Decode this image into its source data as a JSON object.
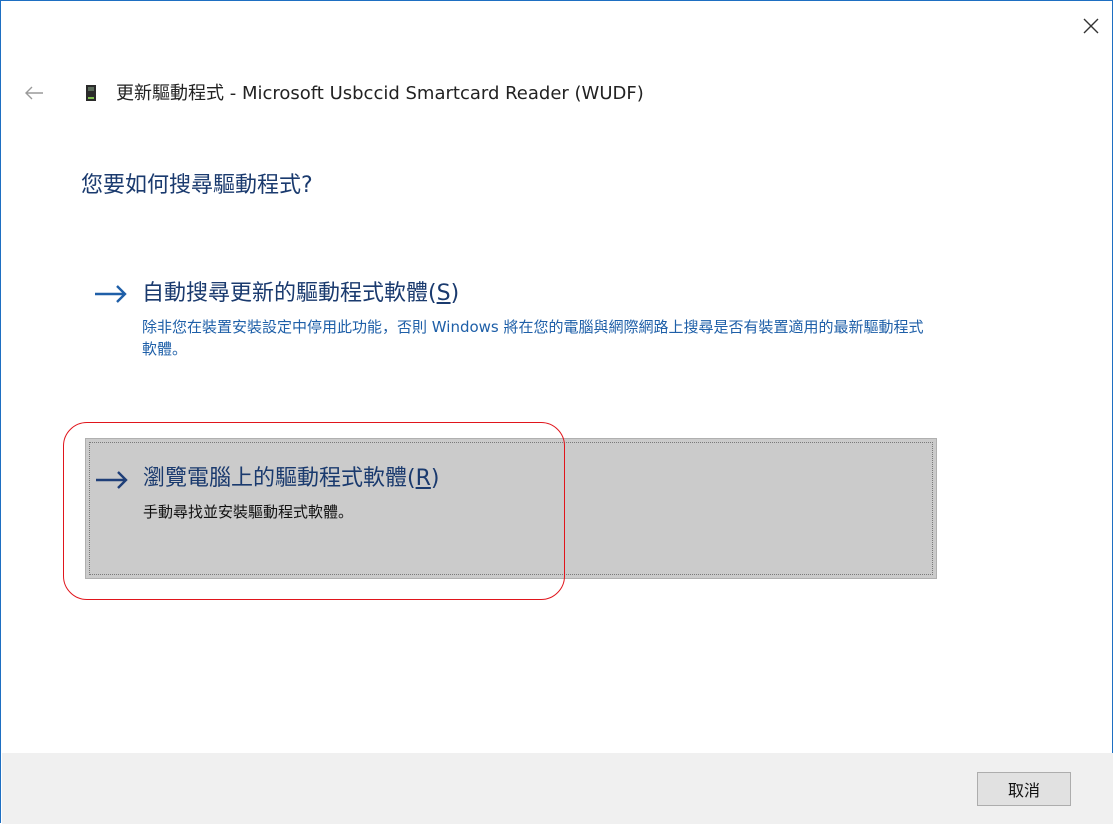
{
  "window": {
    "title": "更新驅動程式 - Microsoft Usbccid Smartcard Reader (WUDF)",
    "accent_color": "#1e6fc2",
    "close_icon": "close-icon",
    "back_icon": "back-arrow-icon",
    "device_icon": "device-icon"
  },
  "main": {
    "heading": "您要如何搜尋驅動程式?",
    "options": [
      {
        "icon": "arrow-right-icon",
        "title": "自動搜尋更新的驅動程式軟體(S)",
        "title_text": "自動搜尋更新的驅動程式軟體(",
        "accelerator": "S",
        "title_end": ")",
        "description": "除非您在裝置安裝設定中停用此功能，否則 Windows 將在您的電腦與網際網路上搜尋是否有裝置適用的最新驅動程式軟體。"
      },
      {
        "icon": "arrow-right-icon",
        "title": "瀏覽電腦上的驅動程式軟體(R)",
        "title_text": "瀏覽電腦上的驅動程式軟體(",
        "accelerator": "R",
        "title_end": ")",
        "description": "手動尋找並安裝驅動程式軟體。",
        "selected": true
      }
    ]
  },
  "annotation": {
    "highlight_color": "#e0151c"
  },
  "footer": {
    "cancel_label": "取消"
  }
}
